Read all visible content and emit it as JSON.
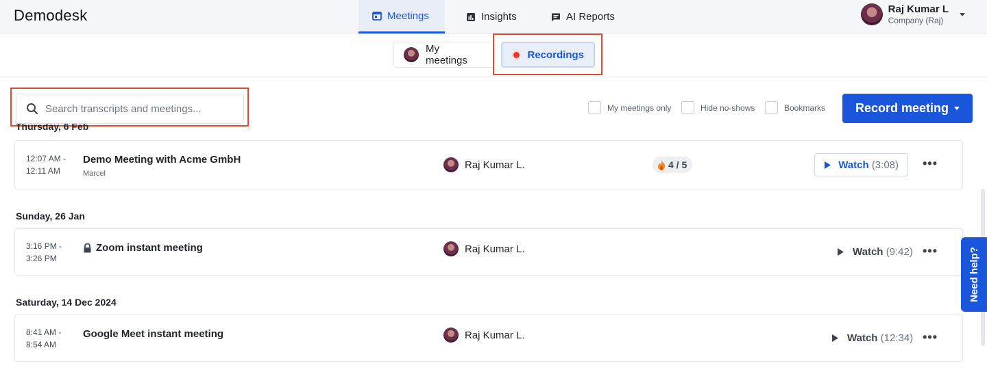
{
  "app": {
    "logo": "Demodesk"
  },
  "nav": {
    "tabs": [
      {
        "label": "Meetings",
        "icon": "calendar-icon",
        "active": true
      },
      {
        "label": "Insights",
        "icon": "bar-chart-icon",
        "active": false
      },
      {
        "label": "AI Reports",
        "icon": "chat-icon",
        "active": false
      }
    ]
  },
  "user": {
    "name": "Raj Kumar L",
    "company": "Company (Raj)"
  },
  "subtabs": [
    {
      "label": "My meetings",
      "active": false
    },
    {
      "label": "Recordings",
      "active": true
    }
  ],
  "search": {
    "placeholder": "Search transcripts and meetings..."
  },
  "filters": {
    "my_meetings_only": "My meetings only",
    "hide_no_shows": "Hide no-shows",
    "bookmarks": "Bookmarks"
  },
  "record_button": "Record meeting",
  "groups": [
    {
      "date": "Thursday, 6 Feb",
      "meetings": [
        {
          "start": "12:07 AM -",
          "end": "12:11 AM",
          "title": "Demo Meeting with Acme GmbH",
          "subtitle": "Marcel",
          "owner": "Raj Kumar L.",
          "score": "4 / 5",
          "watch": "Watch",
          "duration": "(3:08)"
        }
      ]
    },
    {
      "date": "Sunday, 26 Jan",
      "meetings": [
        {
          "start": "3:16 PM -",
          "end": "3:26 PM",
          "title": "Zoom instant meeting",
          "owner": "Raj Kumar L.",
          "watch": "Watch",
          "duration": "(9:42)"
        }
      ]
    },
    {
      "date": "Saturday, 14 Dec 2024",
      "meetings": [
        {
          "start": "8:41 AM -",
          "end": "8:54 AM",
          "title": "Google Meet instant meeting",
          "owner": "Raj Kumar L.",
          "watch": "Watch",
          "duration": "(12:34)"
        }
      ]
    }
  ],
  "help": {
    "label": "Need help?"
  },
  "colors": {
    "accent": "#1a56db",
    "highlight": "#e04a2f",
    "record_dot": "#e53935"
  }
}
